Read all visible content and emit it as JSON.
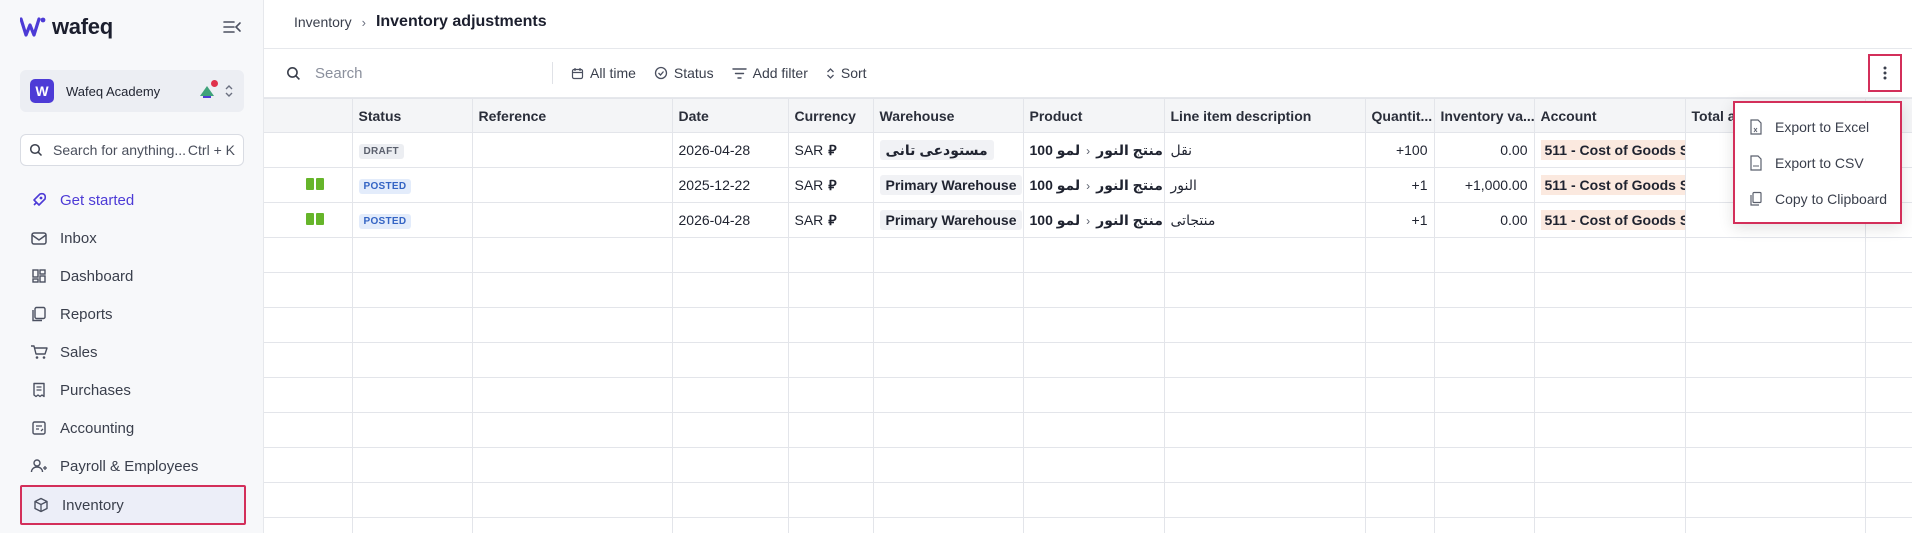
{
  "app": {
    "logo_text": "wafeq"
  },
  "org": {
    "name": "Wafeq Academy",
    "badge": "W"
  },
  "sidebar_search": {
    "placeholder": "Search for anything...",
    "shortcut": "Ctrl + K"
  },
  "nav": [
    {
      "label": "Get started",
      "icon": "rocket-icon"
    },
    {
      "label": "Inbox",
      "icon": "inbox-icon"
    },
    {
      "label": "Dashboard",
      "icon": "dashboard-icon"
    },
    {
      "label": "Reports",
      "icon": "reports-icon"
    },
    {
      "label": "Sales",
      "icon": "cart-icon"
    },
    {
      "label": "Purchases",
      "icon": "receipt-icon"
    },
    {
      "label": "Accounting",
      "icon": "ledger-icon"
    },
    {
      "label": "Payroll & Employees",
      "icon": "people-icon"
    },
    {
      "label": "Inventory",
      "icon": "box-icon"
    }
  ],
  "breadcrumb": {
    "parent": "Inventory",
    "current": "Inventory adjustments"
  },
  "toolbar": {
    "search_placeholder": "Search",
    "all_time": "All time",
    "status": "Status",
    "add_filter": "Add filter",
    "sort": "Sort"
  },
  "table": {
    "headers": {
      "status": "Status",
      "reference": "Reference",
      "date": "Date",
      "currency": "Currency",
      "warehouse": "Warehouse",
      "product": "Product",
      "line": "Line item description",
      "qty": "Quantit...",
      "inv_value": "Inventory va...",
      "account": "Account",
      "total": "Total a"
    },
    "rows": [
      {
        "status": "DRAFT",
        "date": "2026-04-28",
        "currency": "SAR",
        "warehouse": "مستودعى تانى",
        "product_a": "100 منتج النور",
        "product_b": "لمو",
        "line": "نقل",
        "qty": "+100",
        "value": "0.00",
        "account": "511 - Cost of Goods S"
      },
      {
        "status": "POSTED",
        "date": "2025-12-22",
        "currency": "SAR",
        "warehouse": "Primary Warehouse",
        "product_a": "100 منتج النور",
        "product_b": "لمو",
        "line": "النور",
        "qty": "+1",
        "value": "+1,000.00",
        "account": "511 - Cost of Goods S"
      },
      {
        "status": "POSTED",
        "date": "2026-04-28",
        "currency": "SAR",
        "warehouse": "Primary Warehouse",
        "product_a": "100 منتج النور",
        "product_b": "لمو",
        "line": "منتجاتى",
        "qty": "+1",
        "value": "0.00",
        "account": "511 - Cost of Goods S"
      }
    ]
  },
  "export_menu": {
    "excel": "Export to Excel",
    "csv": "Export to CSV",
    "clipboard": "Copy to Clipboard"
  }
}
